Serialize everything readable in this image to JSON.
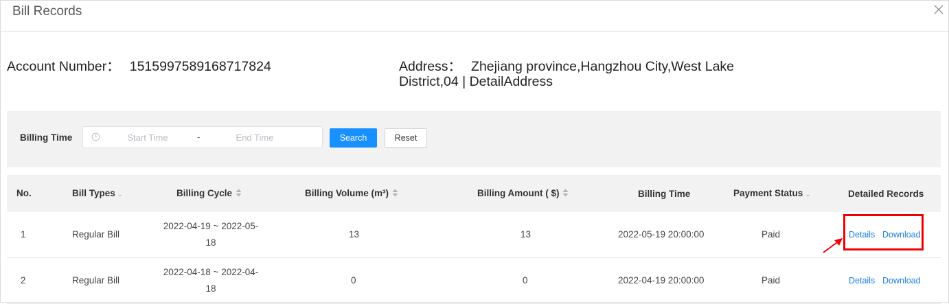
{
  "dialog": {
    "title": "Bill Records"
  },
  "account": {
    "label": "Account Number：",
    "value": "1515997589168717824"
  },
  "address": {
    "label": "Address：",
    "value_line1": "Zhejiang province,Hangzhou City,West Lake",
    "value_line2": "District,04 | DetailAddress"
  },
  "filter": {
    "billing_time_label": "Billing Time",
    "start_placeholder": "Start Time",
    "separator": "-",
    "end_placeholder": "End Time",
    "search_label": "Search",
    "reset_label": "Reset"
  },
  "table": {
    "columns": {
      "no": "No.",
      "bill_types": "Bill Types",
      "billing_cycle": "Billing Cycle",
      "billing_volume": "Billing Volume (m³)",
      "billing_amount": "Billing Amount ( $)",
      "billing_time": "Billing Time",
      "payment_status": "Payment Status",
      "detailed_records": "Detailed Records"
    },
    "rows": [
      {
        "no": "1",
        "bill_type": "Regular Bill",
        "cycle_line1": "2022-04-19 ~ 2022-05-",
        "cycle_line2": "18",
        "volume": "13",
        "amount": "13",
        "billing_time": "2022-05-19 20:00:00",
        "status": "Paid",
        "details_label": "Details",
        "download_label": "Download"
      },
      {
        "no": "2",
        "bill_type": "Regular Bill",
        "cycle_line1": "2022-04-18 ~ 2022-04-",
        "cycle_line2": "18",
        "volume": "0",
        "amount": "0",
        "billing_time": "2022-04-19 20:00:00",
        "status": "Paid",
        "details_label": "Details",
        "download_label": "Download"
      }
    ]
  },
  "colors": {
    "primary": "#1890ff",
    "link": "#1d7fe0",
    "annotation": "#f00000",
    "panel_bg": "#f2f2f2"
  }
}
